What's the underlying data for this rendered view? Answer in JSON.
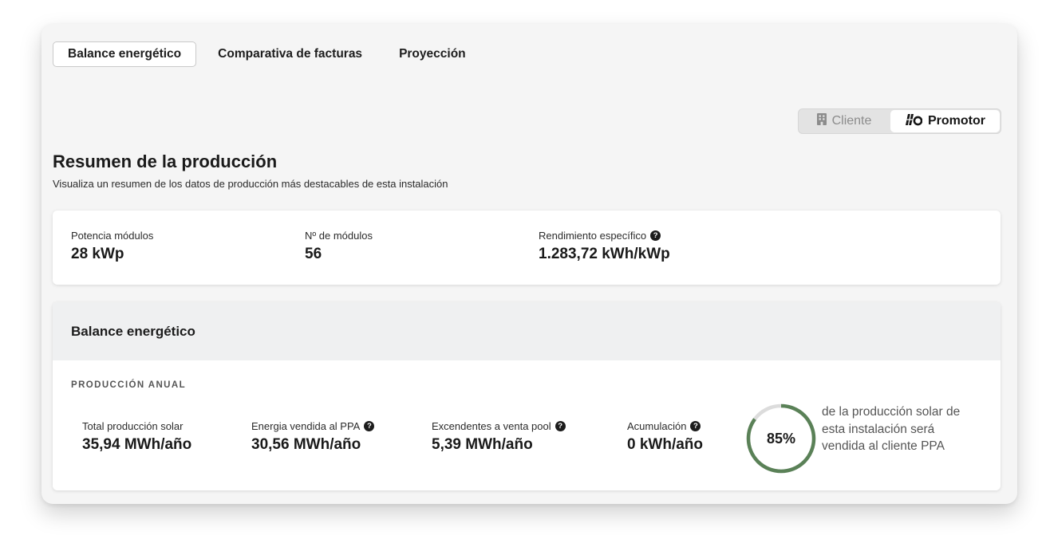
{
  "tabs": [
    {
      "label": "Balance energético",
      "active": true
    },
    {
      "label": "Comparativa de facturas",
      "active": false
    },
    {
      "label": "Proyección",
      "active": false
    }
  ],
  "role_toggle": {
    "options": [
      {
        "label": "Cliente",
        "icon": "building-icon",
        "selected": false
      },
      {
        "label": "Promotor",
        "icon": "solar-panel-icon",
        "selected": true
      }
    ]
  },
  "summary": {
    "title": "Resumen de la producción",
    "subtitle": "Visualiza un resumen de los datos de producción más destacables de esta instalación",
    "stats": [
      {
        "label": "Potencia módulos",
        "value": "28 kWp",
        "help": false
      },
      {
        "label": "Nº de módulos",
        "value": "56",
        "help": false
      },
      {
        "label": "Rendimiento específico",
        "value": "1.283,72 kWh/kWp",
        "help": true
      }
    ]
  },
  "balance": {
    "title": "Balance energético",
    "section_label": "PRODUCCIÓN ANUAL",
    "stats": [
      {
        "label": "Total producción solar",
        "value": "35,94 MWh/año",
        "help": false
      },
      {
        "label": "Energia vendida al PPA",
        "value": "30,56 MWh/año",
        "help": true
      },
      {
        "label": "Excendentes a venta pool",
        "value": "5,39 MWh/año",
        "help": true
      },
      {
        "label": "Acumulación",
        "value": "0 kWh/año",
        "help": true
      }
    ],
    "gauge": {
      "percent": 85,
      "label": "85%",
      "description": "de la producción solar de esta instalación será vendida al cliente PPA",
      "color": "#5a8157",
      "track_color": "#dcdcdc"
    }
  }
}
